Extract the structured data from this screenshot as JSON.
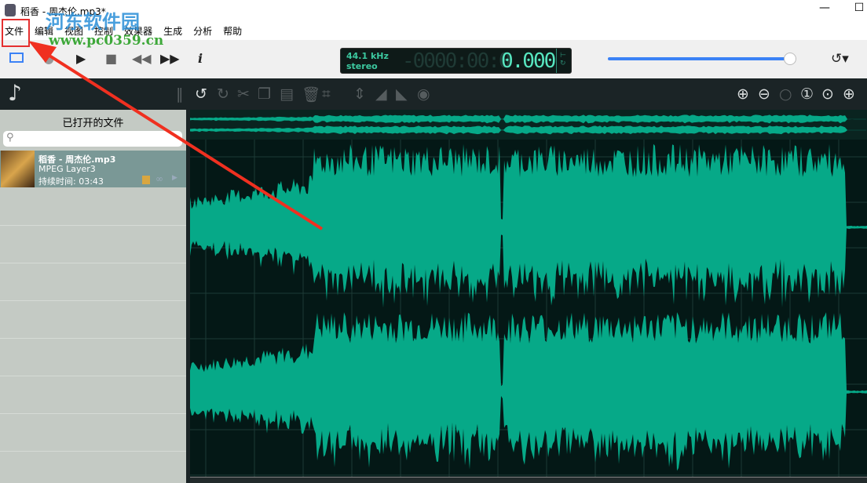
{
  "window": {
    "title": "稻香 - 周杰伦.mp3*",
    "minimize": "—",
    "maximize": "☐"
  },
  "menu": [
    "文件",
    "编辑",
    "视图",
    "控制",
    "效果器",
    "生成",
    "分析",
    "帮助"
  ],
  "transport": {
    "info": "i"
  },
  "display": {
    "rate": "44.1 kHz",
    "channels": "stereo",
    "time_dim": "-0000:00:0",
    "time": "0.000"
  },
  "volume": 0.95,
  "panel": {
    "title": "已打开的文件",
    "search_placeholder": ""
  },
  "file": {
    "name": "稻香 - 周杰伦.mp3",
    "format": "MPEG Layer3",
    "duration": "持续时间: 03:43"
  },
  "watermark": {
    "name": "河东软件园",
    "url": "www.pc0359.cn"
  },
  "colors": {
    "wave": "#06a988",
    "bg": "#041816",
    "accent": "#3b82f6"
  }
}
